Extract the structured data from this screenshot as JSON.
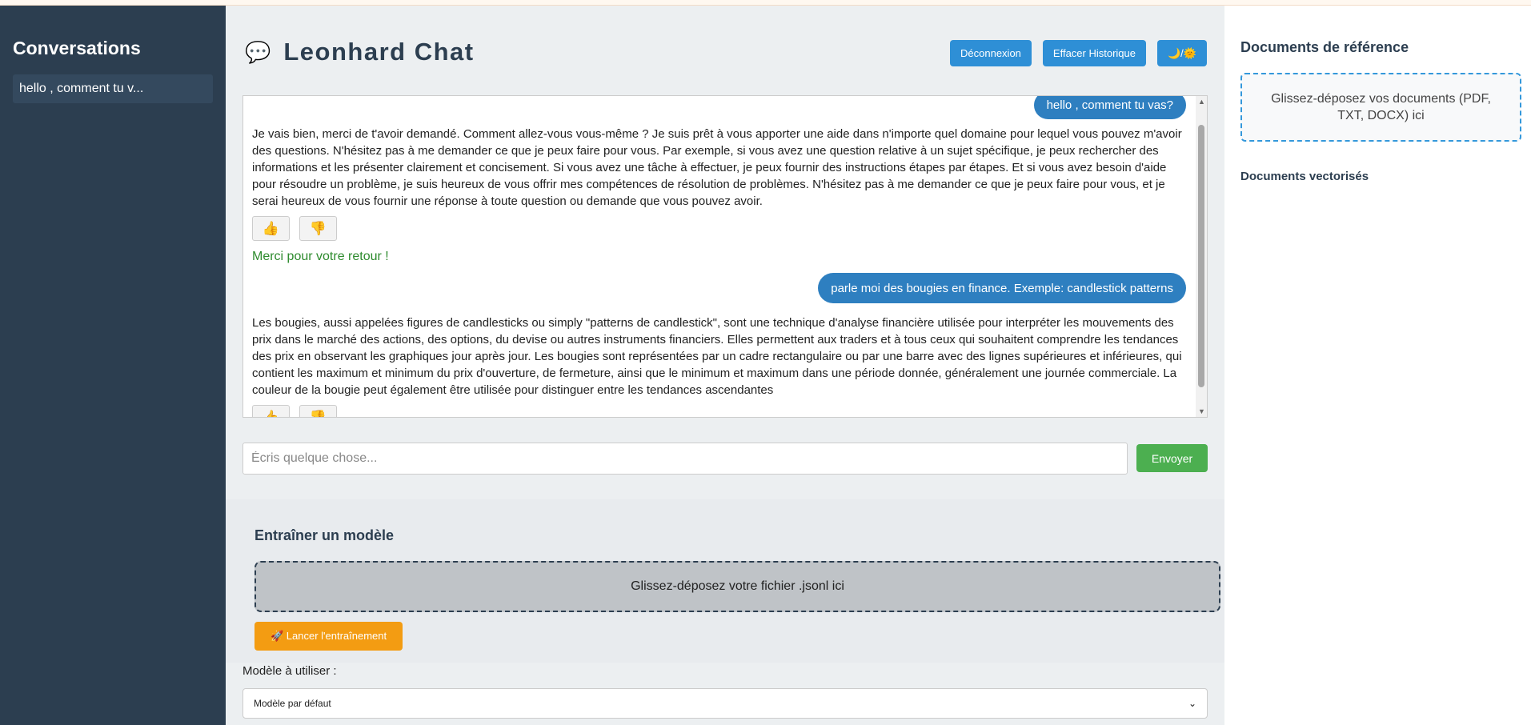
{
  "sidebar": {
    "title": "Conversations",
    "items": [
      {
        "label": "hello , comment tu v..."
      }
    ]
  },
  "header": {
    "title": "Leonhard Chat",
    "icon": "speech-bubble-icon",
    "buttons": {
      "logout": "Déconnexion",
      "clear_history": "Effacer Historique",
      "theme_toggle": "🌙/🌞"
    }
  },
  "chat": {
    "messages": [
      {
        "role": "user",
        "text": "hello , comment tu vas?"
      },
      {
        "role": "assistant",
        "text": "Je vais bien, merci de t'avoir demandé. Comment allez-vous vous-même ? Je suis prêt à vous apporter une aide dans n'importe quel domaine pour lequel vous pouvez m'avoir des questions. N'hésitez pas à me demander ce que je peux faire pour vous. Par exemple, si vous avez une question relative à un sujet spécifique, je peux rechercher des informations et les présenter clairement et concisement. Si vous avez une tâche à effectuer, je peux fournir des instructions étapes par étapes. Et si vous avez besoin d'aide pour résoudre un problème, je suis heureux de vous offrir mes compétences de résolution de problèmes. N'hésitez pas à me demander ce que je peux faire pour vous, et je serai heureux de vous fournir une réponse à toute question ou demande que vous pouvez avoir."
      },
      {
        "role": "user",
        "text": "parle moi des bougies en finance. Exemple: candlestick patterns"
      },
      {
        "role": "assistant",
        "text": "Les bougies, aussi appelées figures de candlesticks ou simply \"patterns de candlestick\", sont une technique d'analyse financière utilisée pour interpréter les mouvements des prix dans le marché des actions, des options, du devise ou autres instruments financiers. Elles permettent aux traders et à tous ceux qui souhaitent comprendre les tendances des prix en observant les graphiques jour après jour. Les bougies sont représentées par un cadre rectangulaire ou par une barre avec des lignes supérieures et inférieures, qui contient les maximum et minimum du prix d'ouverture, de fermeture, ainsi que le minimum et maximum dans une période donnée, généralement une journée commerciale. La couleur de la bougie peut également être utilisée pour distinguer entre les tendances ascendantes"
      }
    ],
    "feedback": {
      "up": "👍",
      "down": "👎"
    },
    "thanks": "Merci pour votre retour !",
    "input_placeholder": "Écris quelque chose...",
    "send_label": "Envoyer"
  },
  "training": {
    "title": "Entraîner un modèle",
    "dropzone": "Glissez-déposez votre fichier .jsonl ici",
    "start_button": "🚀 Lancer l'entraînement"
  },
  "model": {
    "label": "Modèle à utiliser :",
    "selected": "Modèle par défaut"
  },
  "right_panel": {
    "title": "Documents de référence",
    "dropzone": "Glissez-déposez vos documents (PDF, TXT, DOCX) ici",
    "vectorized_title": "Documents vectorisés"
  },
  "colors": {
    "sidebar_bg": "#2c3e50",
    "accent_blue": "#2e8fd6",
    "send_green": "#4caf50",
    "train_orange": "#f39c12"
  }
}
